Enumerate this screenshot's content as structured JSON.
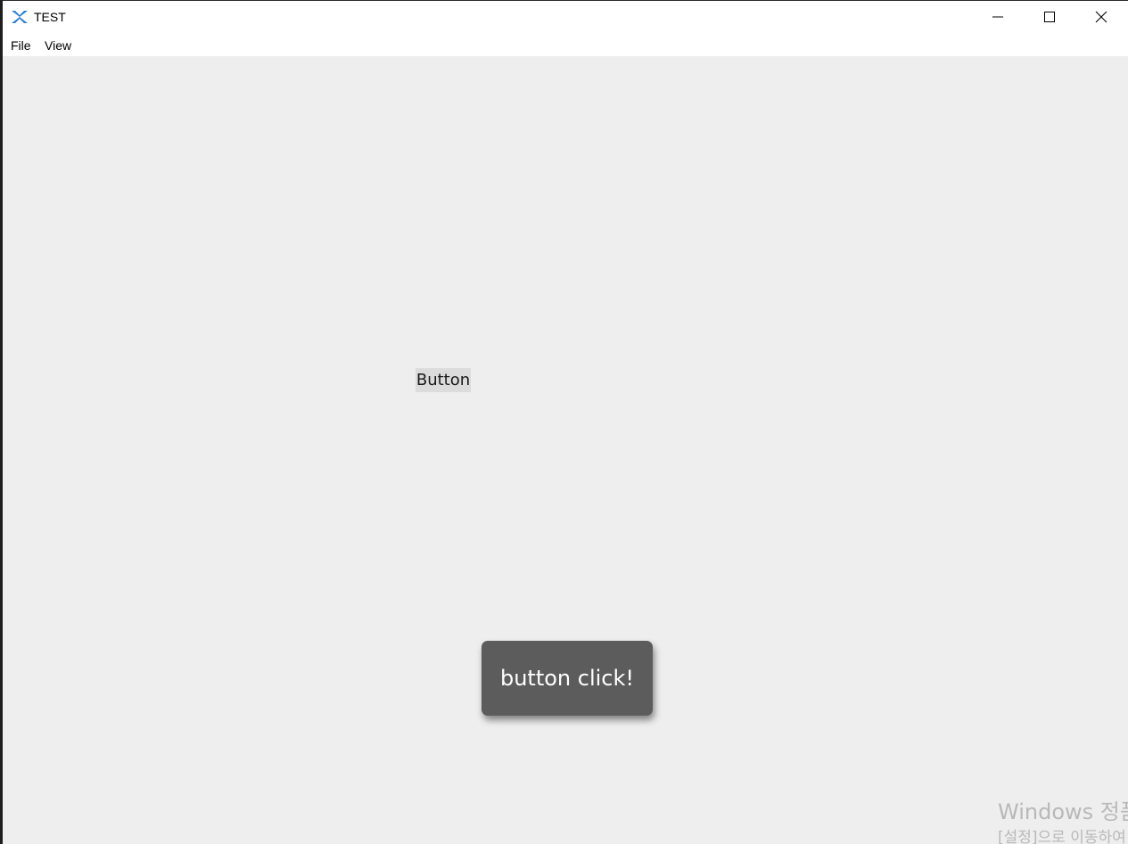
{
  "window": {
    "title": "TEST",
    "app_icon": "app-logo-icon",
    "controls": {
      "minimize_icon": "minimize-icon",
      "maximize_icon": "maximize-icon",
      "close_icon": "close-icon"
    }
  },
  "menubar": {
    "items": [
      {
        "label": "File"
      },
      {
        "label": "View"
      }
    ]
  },
  "content": {
    "button_label": "Button",
    "toast_message": "button click!",
    "background_color": "#eeeeee",
    "toast_color": "#5c5c5c"
  },
  "watermark": {
    "line1": "Windows 정품",
    "line2": "[설정]으로 이동하여"
  }
}
